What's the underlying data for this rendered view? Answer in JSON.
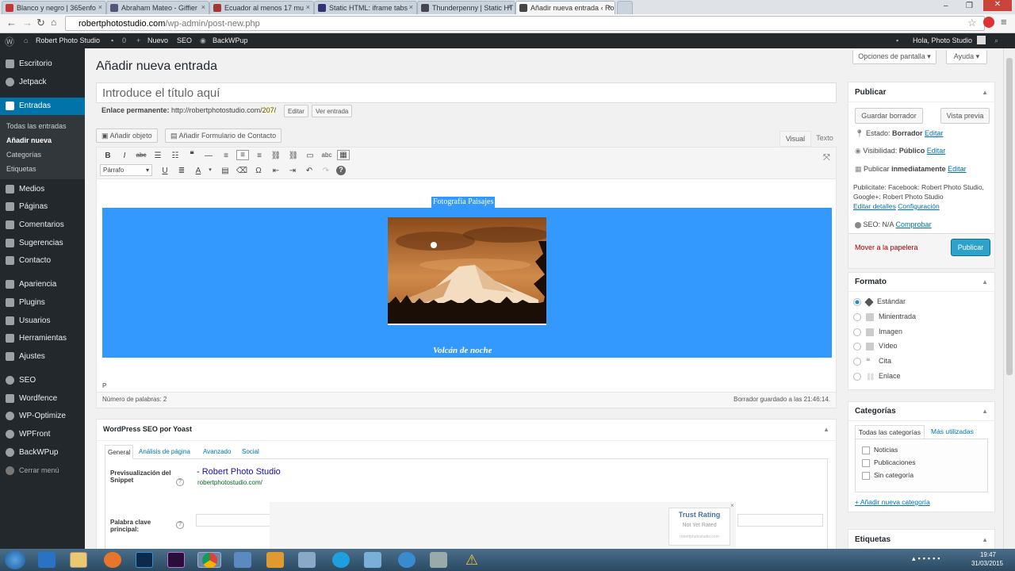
{
  "browser": {
    "tabs": [
      "Blanco y negro | 365enfo",
      "Abraham Mateo - Giffier",
      "Ecuador al menos 17 mu",
      "Static HTML: iframe tabs",
      "Thunderpenny | Static HT",
      "Añadir nueva entrada ‹ Ro"
    ],
    "active_tab_index": 5,
    "url_host": "robertphotostudio.com",
    "url_path": "/wp-admin/post-new.php"
  },
  "adminbar": {
    "site": "Robert Photo Studio",
    "comments": "0",
    "new": "Nuevo",
    "seo": "SEO",
    "backup": "BackWPup",
    "greeting": "Hola, Photo Studio"
  },
  "menu": {
    "items": [
      "Escritorio",
      "Jetpack",
      "Entradas",
      "Medios",
      "Páginas",
      "Comentarios",
      "Sugerencias",
      "Contacto",
      "Apariencia",
      "Plugins",
      "Usuarios",
      "Herramientas",
      "Ajustes",
      "SEO",
      "Wordfence",
      "WP-Optimize",
      "WPFront",
      "BackWPup",
      "Cerrar menú"
    ],
    "current": "Entradas",
    "submenu": [
      "Todas las entradas",
      "Añadir nueva",
      "Categorías",
      "Etiquetas"
    ],
    "submenu_current": "Añadir nueva"
  },
  "screen": {
    "options": "Opciones de pantalla",
    "help": "Ayuda"
  },
  "page": {
    "heading": "Añadir nueva entrada",
    "title_placeholder": "Introduce el título aquí",
    "permalink_label": "Enlace permanente:",
    "permalink_url": "http://robertphotostudio.com/",
    "permalink_id": "207",
    "permalink_tail": "/",
    "edit_btn": "Editar",
    "view_btn": "Ver entrada",
    "add_media": "Añadir objeto",
    "add_form": "Añadir Formulario de Contacto",
    "tab_visual": "Visual",
    "tab_text": "Texto",
    "format_select": "Párrafo",
    "content_heading": "Fotografía Paisajes",
    "content_caption": "Volcán de noche",
    "path": "P",
    "word_count": "Número de palabras: 2",
    "autosave": "Borrador guardado a las 21:46:14."
  },
  "yoast": {
    "title": "WordPress SEO por Yoast",
    "tabs": [
      "General",
      "Análisis de página",
      "Avanzado",
      "Social"
    ],
    "snippet_label": "Previsualización del Snippet",
    "snippet_title": "- Robert Photo Studio",
    "snippet_url": "robertphotostudio.com/",
    "keyword_label": "Palabra clave principal:",
    "help": "?"
  },
  "publish": {
    "title": "Publicar",
    "save_draft": "Guardar borrador",
    "preview": "Vista previa",
    "status_label": "Estado:",
    "status_value": "Borrador",
    "visibility_label": "Visibilidad:",
    "visibility_value": "Público",
    "schedule": "Publicar",
    "schedule_value": "inmediatamente",
    "edit": "Editar",
    "publicize": "Publicitate: Facebook: Robert Photo Studio, Google+: Robert Photo Studio",
    "edit_details": "Editar detalles",
    "config": "Configuración",
    "seo_label": "SEO: N/A",
    "seo_check": "Comprobar",
    "trash": "Mover a la papelera",
    "publish_btn": "Publicar"
  },
  "format": {
    "title": "Formato",
    "options": [
      "Estándar",
      "Minientrada",
      "Imagen",
      "Vídeo",
      "Cita",
      "Enlace"
    ],
    "selected": "Estándar"
  },
  "categories": {
    "title": "Categorías",
    "tab_all": "Todas las categorías",
    "tab_used": "Más utilizadas",
    "items": [
      "Noticias",
      "Publicaciones",
      "Sin categoría"
    ],
    "add": "+ Añadir nueva categoría"
  },
  "tags": {
    "title": "Etiquetas"
  },
  "trust": {
    "title": "Trust Rating",
    "status": "Not Yet Rated",
    "site": "robertphotostudio.com"
  },
  "clock": {
    "time": "19:47",
    "date": "31/03/2015"
  },
  "colors": {
    "admin": "#23282d",
    "accent": "#0073aa",
    "selection": "#3399ff",
    "publish": "#2ea2cc"
  }
}
